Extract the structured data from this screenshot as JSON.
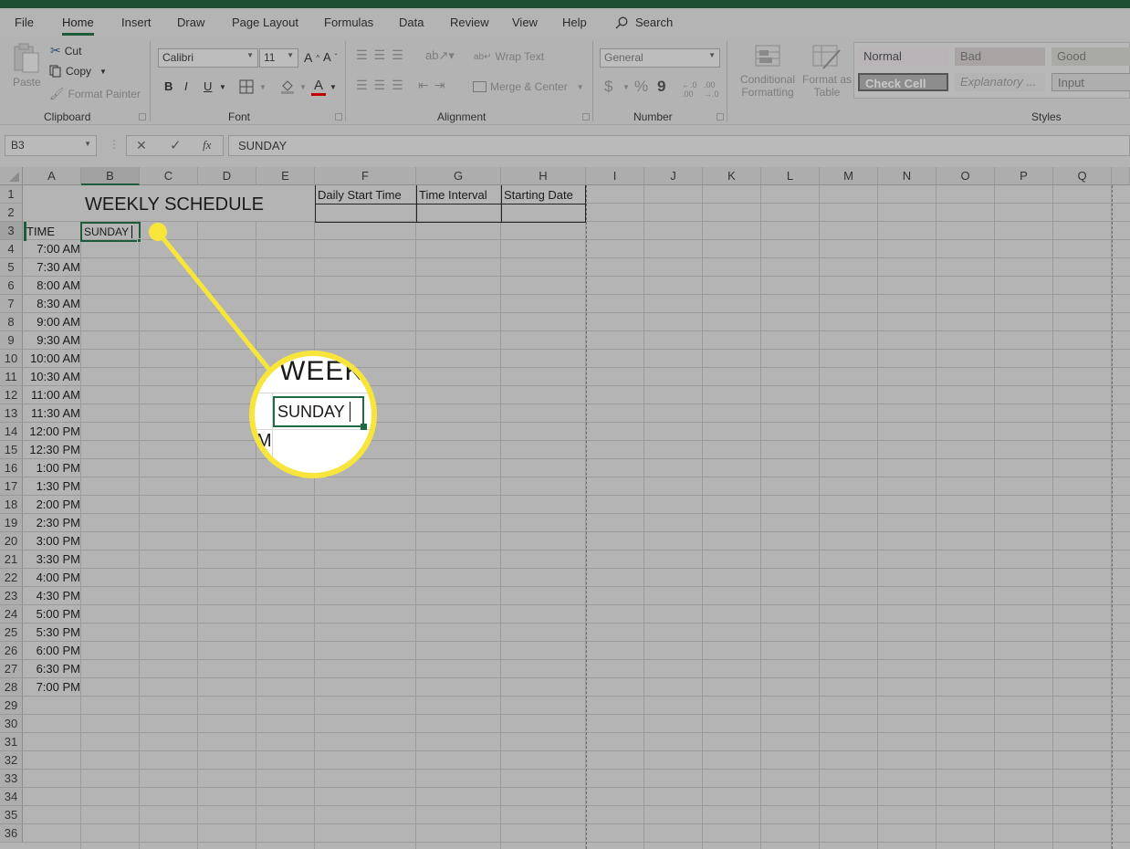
{
  "window": {
    "titlebar_color": "#1d4e32"
  },
  "tabs": [
    {
      "label": "File",
      "active": false
    },
    {
      "label": "Home",
      "active": true
    },
    {
      "label": "Insert",
      "active": false
    },
    {
      "label": "Draw",
      "active": false
    },
    {
      "label": "Page Layout",
      "active": false
    },
    {
      "label": "Formulas",
      "active": false
    },
    {
      "label": "Data",
      "active": false
    },
    {
      "label": "Review",
      "active": false
    },
    {
      "label": "View",
      "active": false
    },
    {
      "label": "Help",
      "active": false
    }
  ],
  "search": {
    "label": "Search"
  },
  "ribbon": {
    "clipboard": {
      "label": "Clipboard",
      "paste": "Paste",
      "cut": "Cut",
      "copy": "Copy",
      "format_painter": "Format Painter"
    },
    "font": {
      "label": "Font",
      "font_name": "Calibri",
      "font_size": "11",
      "bold": "B",
      "italic": "I",
      "underline": "U",
      "font_color_accent": "#c00000"
    },
    "alignment": {
      "label": "Alignment",
      "wrap_text": "Wrap Text",
      "merge_center": "Merge & Center"
    },
    "number": {
      "label": "Number",
      "format": "General",
      "currency": "$",
      "percent": "%",
      "comma": "9"
    },
    "styles": {
      "label": "Styles",
      "conditional_formatting": [
        "Conditional",
        "Formatting"
      ],
      "format_as_table": [
        "Format as",
        "Table"
      ],
      "cells": [
        {
          "label": "Normal"
        },
        {
          "label": "Bad"
        },
        {
          "label": "Good"
        },
        {
          "label": "Check Cell"
        },
        {
          "label": "Explanatory ..."
        },
        {
          "label": "Input"
        }
      ]
    }
  },
  "formula_bar": {
    "name_box": "B3",
    "cancel": "✕",
    "enter": "✓",
    "fx": "fx",
    "value": "SUNDAY"
  },
  "sheet": {
    "columns": [
      "A",
      "B",
      "C",
      "D",
      "E",
      "F",
      "G",
      "H",
      "I",
      "J",
      "K",
      "L",
      "M",
      "N",
      "O",
      "P",
      "Q"
    ],
    "selected_column": "B",
    "rows": [
      "1",
      "2",
      "3",
      "4",
      "5",
      "6",
      "7",
      "8",
      "9",
      "10",
      "11",
      "12",
      "13",
      "14",
      "15",
      "16",
      "17",
      "18",
      "19",
      "20",
      "21",
      "22",
      "23",
      "24",
      "25",
      "26",
      "27",
      "28",
      "29",
      "30",
      "31",
      "32",
      "33",
      "34",
      "35",
      "36"
    ],
    "title": "WEEKLY SCHEDULE",
    "time_header": "TIME",
    "active_cell": {
      "ref": "B3",
      "value": "SUNDAY"
    },
    "settings_headers": [
      "Daily Start Time",
      "Time Interval",
      "Starting Date"
    ],
    "times": [
      "7:00 AM",
      "7:30 AM",
      "8:00 AM",
      "8:30 AM",
      "9:00 AM",
      "9:30 AM",
      "10:00 AM",
      "10:30 AM",
      "11:00 AM",
      "11:30 AM",
      "12:00 PM",
      "12:30 PM",
      "1:00 PM",
      "1:30 PM",
      "2:00 PM",
      "2:30 PM",
      "3:00 PM",
      "3:30 PM",
      "4:00 PM",
      "4:30 PM",
      "5:00 PM",
      "5:30 PM",
      "6:00 PM",
      "6:30 PM",
      "7:00 PM"
    ]
  },
  "callout": {
    "color": "#f7e53c",
    "zoom_title_fragment": "WEEKL",
    "zoom_cell_value": "SUNDAY",
    "zoom_row_fragment": "M"
  }
}
